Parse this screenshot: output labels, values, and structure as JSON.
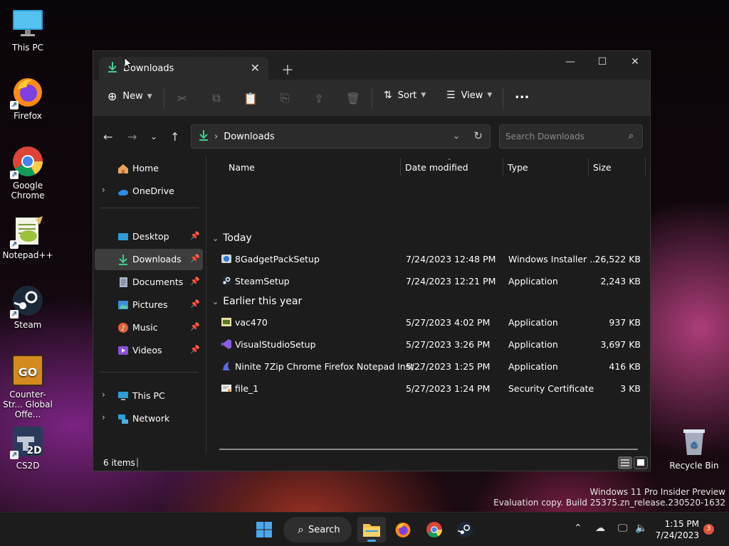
{
  "desktop": {
    "icons": [
      {
        "label": "This PC",
        "icon": "monitor-icon"
      },
      {
        "label": "Firefox",
        "icon": "firefox-icon"
      },
      {
        "label": "Google Chrome",
        "icon": "chrome-icon"
      },
      {
        "label": "Notepad++",
        "icon": "notepadpp-icon"
      },
      {
        "label": "Steam",
        "icon": "steam-icon"
      },
      {
        "label": "Counter-Str... Global Offe...",
        "icon": "csgo-icon"
      },
      {
        "label": "CS2D",
        "icon": "cs2d-icon"
      },
      {
        "label": "Recycle Bin",
        "icon": "recycle-bin-icon"
      }
    ],
    "watermark": [
      "Windows 11 Pro Insider Preview",
      "Evaluation copy. Build 25375.zn_release.230520-1632"
    ]
  },
  "explorer": {
    "tab_title": "Downloads",
    "toolbar": {
      "new_label": "New",
      "sort_label": "Sort",
      "view_label": "View",
      "more_label": "..."
    },
    "address": {
      "path_label": "Downloads",
      "search_placeholder": "Search Downloads"
    },
    "sidebar": {
      "home": "Home",
      "onedrive": "OneDrive",
      "pinned": [
        {
          "label": "Desktop",
          "icon": "desktop-folder-icon"
        },
        {
          "label": "Downloads",
          "icon": "downloads-folder-icon",
          "active": true
        },
        {
          "label": "Documents",
          "icon": "documents-folder-icon"
        },
        {
          "label": "Pictures",
          "icon": "pictures-folder-icon"
        },
        {
          "label": "Music",
          "icon": "music-folder-icon"
        },
        {
          "label": "Videos",
          "icon": "videos-folder-icon"
        }
      ],
      "this_pc": "This PC",
      "network": "Network"
    },
    "columns": {
      "name": "Name",
      "date": "Date modified",
      "type": "Type",
      "size": "Size"
    },
    "groups": [
      {
        "label": "Today",
        "files": [
          {
            "name": "8GadgetPackSetup",
            "date": "7/24/2023 12:48 PM",
            "type": "Windows Installer ...",
            "size": "26,522 KB",
            "icon": "installer-icon"
          },
          {
            "name": "SteamSetup",
            "date": "7/24/2023 12:21 PM",
            "type": "Application",
            "size": "2,243 KB",
            "icon": "steam-setup-icon"
          }
        ]
      },
      {
        "label": "Earlier this year",
        "files": [
          {
            "name": "vac470",
            "date": "5/27/2023 4:02 PM",
            "type": "Application",
            "size": "937 KB",
            "icon": "app-icon"
          },
          {
            "name": "VisualStudioSetup",
            "date": "5/27/2023 3:26 PM",
            "type": "Application",
            "size": "3,697 KB",
            "icon": "visual-studio-icon"
          },
          {
            "name": "Ninite 7Zip Chrome Firefox Notepad Inst...",
            "date": "5/27/2023 1:25 PM",
            "type": "Application",
            "size": "416 KB",
            "icon": "ninite-icon"
          },
          {
            "name": "file_1",
            "date": "5/27/2023 1:24 PM",
            "type": "Security Certificate",
            "size": "3 KB",
            "icon": "certificate-icon"
          }
        ]
      }
    ],
    "status": {
      "item_count": "6 items",
      "cursor": "|"
    }
  },
  "taskbar": {
    "search_label": "Search",
    "time": "1:15 PM",
    "date": "7/24/2023",
    "notification_count": "3"
  }
}
